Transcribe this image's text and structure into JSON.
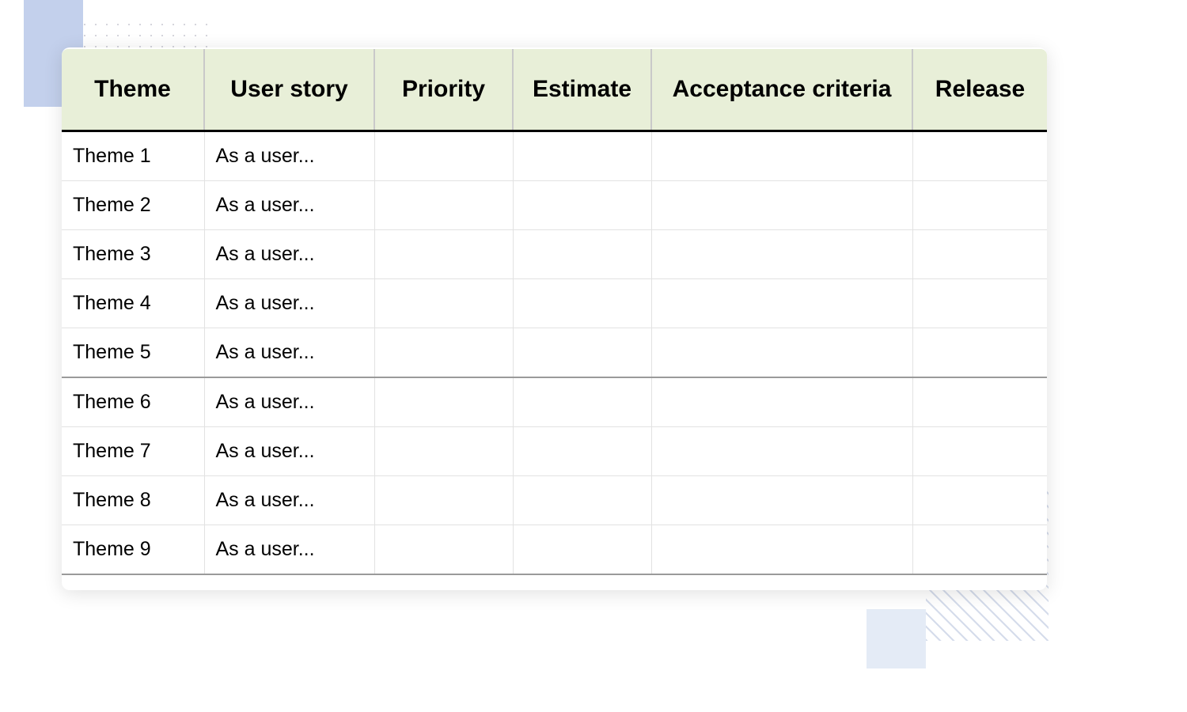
{
  "table": {
    "headers": {
      "theme": "Theme",
      "user_story": "User story",
      "priority": "Priority",
      "estimate": "Estimate",
      "acceptance": "Acceptance criteria",
      "release": "Release"
    },
    "rows": [
      {
        "theme": "Theme 1",
        "user_story": "As a user...",
        "priority": "",
        "estimate": "",
        "acceptance": "",
        "release": "",
        "group_end": false
      },
      {
        "theme": "Theme 2",
        "user_story": "As a user...",
        "priority": "",
        "estimate": "",
        "acceptance": "",
        "release": "",
        "group_end": false
      },
      {
        "theme": "Theme 3",
        "user_story": "As a user...",
        "priority": "",
        "estimate": "",
        "acceptance": "",
        "release": "",
        "group_end": false
      },
      {
        "theme": "Theme 4",
        "user_story": "As a user...",
        "priority": "",
        "estimate": "",
        "acceptance": "",
        "release": "",
        "group_end": false
      },
      {
        "theme": "Theme 5",
        "user_story": "As a user...",
        "priority": "",
        "estimate": "",
        "acceptance": "",
        "release": "",
        "group_end": true
      },
      {
        "theme": "Theme 6",
        "user_story": "As a user...",
        "priority": "",
        "estimate": "",
        "acceptance": "",
        "release": "",
        "group_end": false
      },
      {
        "theme": "Theme 7",
        "user_story": "As a user...",
        "priority": "",
        "estimate": "",
        "acceptance": "",
        "release": "",
        "group_end": false
      },
      {
        "theme": "Theme 8",
        "user_story": "As a user...",
        "priority": "",
        "estimate": "",
        "acceptance": "",
        "release": "",
        "group_end": false
      },
      {
        "theme": "Theme 9",
        "user_story": "As a user...",
        "priority": "",
        "estimate": "",
        "acceptance": "",
        "release": "",
        "group_end": false
      }
    ]
  }
}
